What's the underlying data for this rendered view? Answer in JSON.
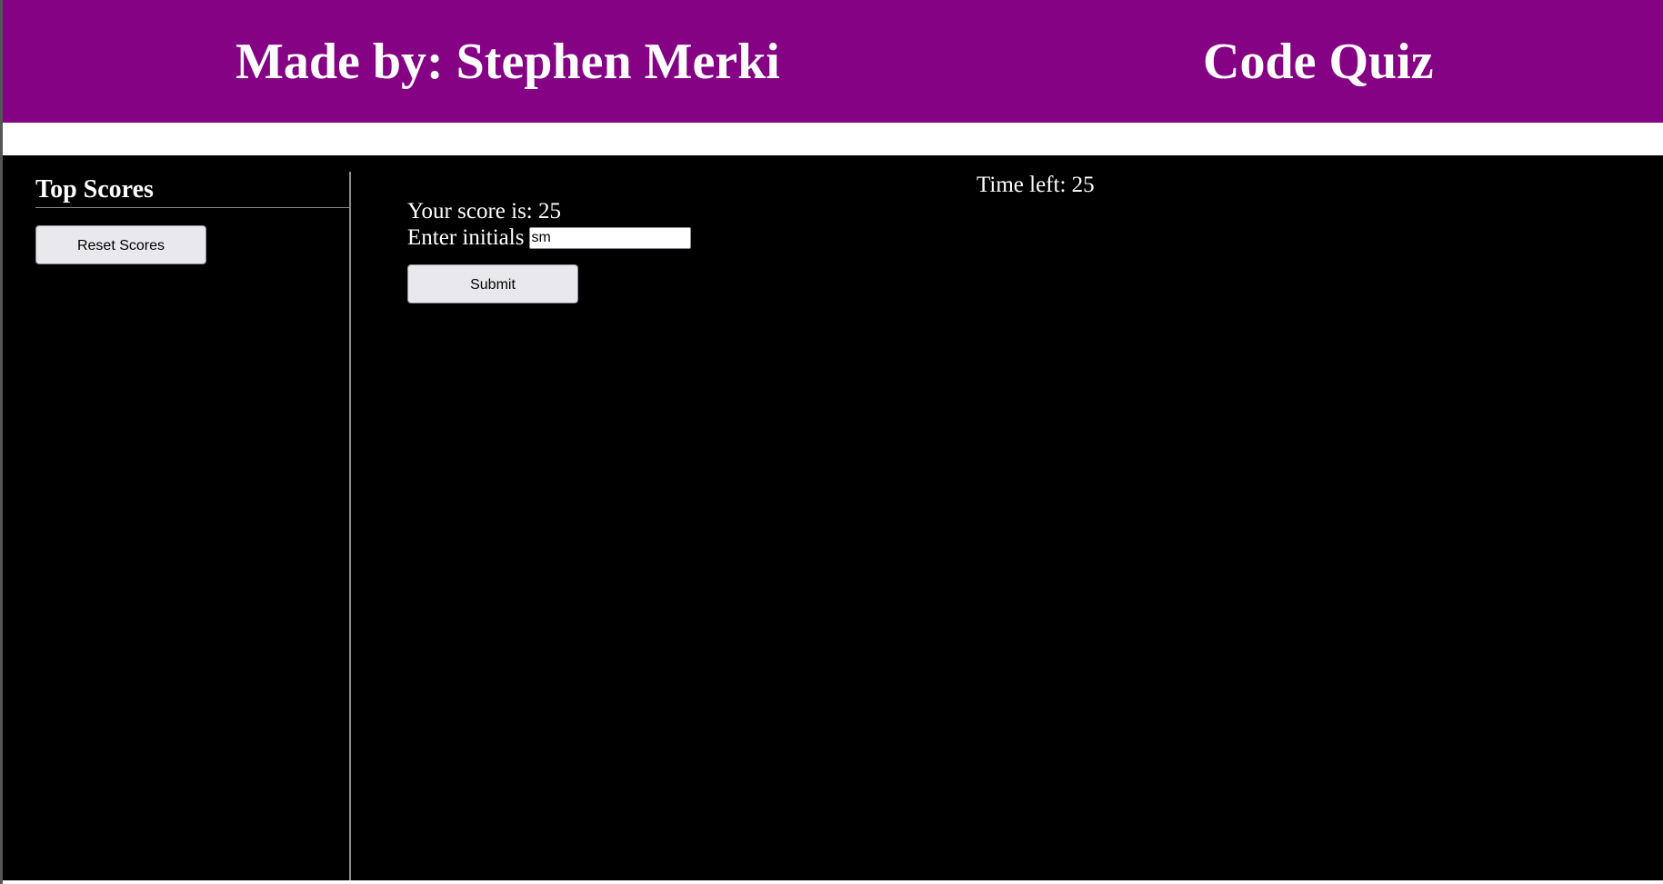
{
  "header": {
    "author_title": "Made by: Stephen Merki",
    "app_title": "Code Quiz",
    "background_color": "#840283"
  },
  "sidebar": {
    "heading": "Top Scores",
    "reset_label": "Reset Scores"
  },
  "quiz": {
    "timer_text": "Time left: 25",
    "score_text": "Your score is: 25",
    "initials_label": "Enter initials",
    "initials_value": "sm",
    "submit_label": "Submit"
  }
}
